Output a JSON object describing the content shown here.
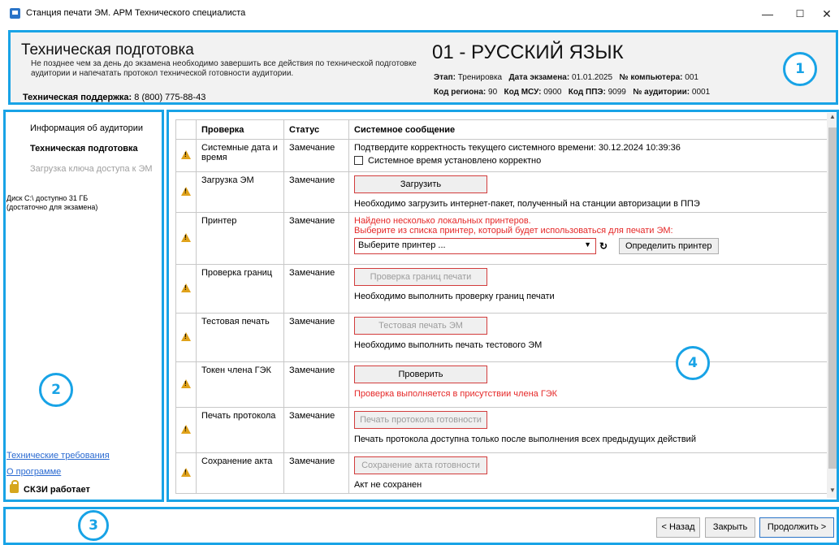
{
  "window": {
    "title": "Станция печати ЭМ. АРМ Технического специалиста",
    "minimize": "—",
    "maximize": "☐",
    "close": "✕"
  },
  "header": {
    "title": "Техническая подготовка",
    "description": "Не позднее чем за день до экзамена необходимо завершить все действия по технической подготовке аудитории и напечатать протокол технической готовности аудитории.",
    "support_label": "Техническая поддержка:",
    "support_phone": "8 (800) 775-88-43",
    "subject": "01 - РУССКИЙ ЯЗЫК",
    "stage_label": "Этап:",
    "stage": "Тренировка",
    "exam_date_label": "Дата экзамена:",
    "exam_date": "01.01.2025",
    "computer_label": "№ компьютера:",
    "computer": "001",
    "region_label": "Код региона:",
    "region": "90",
    "msu_label": "Код МСУ:",
    "msu": "0900",
    "ppe_label": "Код ППЭ:",
    "ppe": "9099",
    "auditorium_label": "№ аудитории:",
    "auditorium": "0001"
  },
  "sidebar": {
    "items": [
      {
        "label": "Информация об аудитории",
        "state": "normal"
      },
      {
        "label": "Техническая подготовка",
        "state": "active"
      },
      {
        "label": "Загрузка ключа доступа к ЭМ",
        "state": "disabled"
      }
    ],
    "disk_line1": "Диск C:\\ доступно 31 ГБ",
    "disk_line2": "(достаточно для экзамена)",
    "link_requirements": "Технические требования",
    "link_about": "О программе",
    "skzi_status": "СКЗИ работает"
  },
  "table": {
    "headers": [
      "Проверка",
      "Статус",
      "Системное сообщение"
    ],
    "rows": [
      {
        "check": "Системные дата и время",
        "status": "Замечание",
        "message": "Подтвердите корректность текущего системного времени: 30.12.2024 10:39:36",
        "checkbox": "Системное время установлено корректно"
      },
      {
        "check": "Загрузка ЭМ",
        "status": "Замечание",
        "button": "Загрузить",
        "message": "Необходимо загрузить интернет-пакет, полученный на станции авторизации в ППЭ"
      },
      {
        "check": "Принтер",
        "status": "Замечание",
        "warn1": "Найдено несколько локальных принтеров.",
        "warn2": "Выберите из списка принтер, который будет использоваться для печати ЭМ:",
        "select": "Выберите принтер ...",
        "detect": "Определить принтер"
      },
      {
        "check": "Проверка границ",
        "status": "Замечание",
        "button": "Проверка границ печати",
        "message": "Необходимо выполнить проверку границ печати"
      },
      {
        "check": "Тестовая печать",
        "status": "Замечание",
        "button": "Тестовая печать ЭМ",
        "message": "Необходимо выполнить печать тестового ЭМ"
      },
      {
        "check": "Токен члена ГЭК",
        "status": "Замечание",
        "button": "Проверить",
        "message": "Проверка выполняется в присутствии члена ГЭК"
      },
      {
        "check": "Печать протокола",
        "status": "Замечание",
        "button": "Печать протокола готовности",
        "message": "Печать протокола доступна только после выполнения всех предыдущих действий"
      },
      {
        "check": "Сохранение акта",
        "status": "Замечание",
        "button": "Сохранение акта готовности",
        "message": "Акт не сохранен"
      }
    ]
  },
  "footer": {
    "back": "< Назад",
    "close": "Закрыть",
    "continue": "Продолжить >"
  },
  "callouts": [
    "1",
    "2",
    "3",
    "4"
  ],
  "colors": {
    "callout": "#18a3e6",
    "warning": "#e0a21a",
    "error_text": "#e52828",
    "link": "#2a6ad1"
  }
}
